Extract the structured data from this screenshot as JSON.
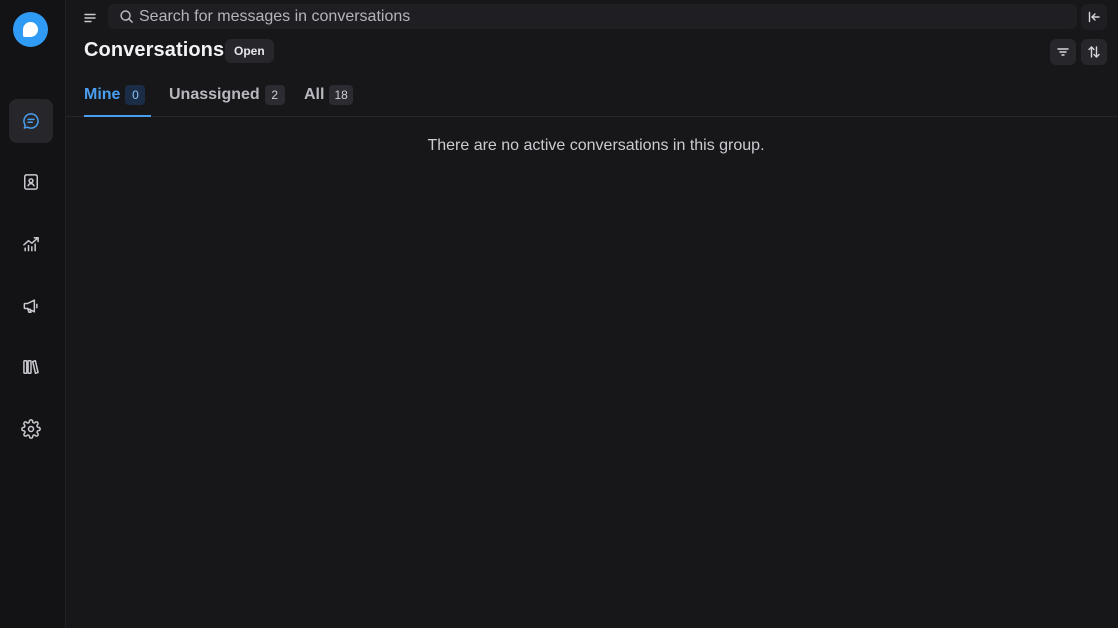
{
  "sidebar": {
    "logo": "chatwoot-logo",
    "items": [
      {
        "icon": "chat-bubble-icon",
        "active": true
      },
      {
        "icon": "contact-book-icon",
        "active": false
      },
      {
        "icon": "trend-chart-icon",
        "active": false
      },
      {
        "icon": "megaphone-icon",
        "active": false
      },
      {
        "icon": "library-icon",
        "active": false
      },
      {
        "icon": "gear-icon",
        "active": false
      }
    ]
  },
  "topbar": {
    "search_placeholder": "Search for messages in conversations",
    "search_value": ""
  },
  "header": {
    "title": "Conversations",
    "status": "Open"
  },
  "tabs": [
    {
      "label": "Mine",
      "count": "0",
      "active": true
    },
    {
      "label": "Unassigned",
      "count": "2",
      "active": false
    },
    {
      "label": "All",
      "count": "18",
      "active": false
    }
  ],
  "empty_message": "There are no active conversations in this group.",
  "colors": {
    "accent": "#4a9ef0",
    "logo": "#2f9bf4",
    "background": "#17171a",
    "rail": "#131316"
  }
}
